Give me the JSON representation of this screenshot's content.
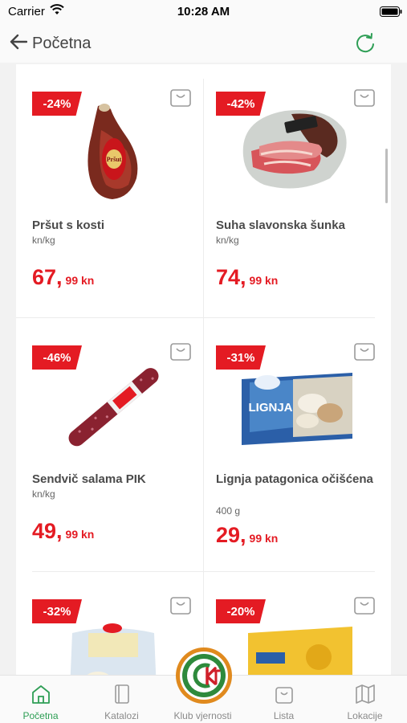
{
  "status_bar": {
    "carrier": "Carrier",
    "time": "10:28 AM"
  },
  "nav": {
    "back_label": "Početna",
    "refresh_icon": "refresh-icon"
  },
  "products": [
    {
      "name": "Pršut s kosti",
      "unit": "kn/kg",
      "price_main": "67,",
      "price_decimal": "99 kn",
      "discount": "-24%",
      "image": "prsut-ham"
    },
    {
      "name": "Suha slavonska šunka",
      "unit": "kn/kg",
      "price_main": "74,",
      "price_decimal": "99 kn",
      "discount": "-42%",
      "image": "sliced-ham"
    },
    {
      "name": "Sendvič salama PIK",
      "unit": "kn/kg",
      "price_main": "49,",
      "price_decimal": "99 kn",
      "discount": "-46%",
      "image": "salami"
    },
    {
      "name": "Lignja patagonica očišćena",
      "unit": "400 g",
      "price_main": "29,",
      "price_decimal": "99 kn",
      "discount": "-31%",
      "image": "squid-box"
    },
    {
      "name": "",
      "unit": "",
      "price_main": "",
      "price_decimal": "",
      "discount": "-32%",
      "image": "squid-rings-pack"
    },
    {
      "name": "",
      "unit": "",
      "price_main": "",
      "price_decimal": "",
      "discount": "-20%",
      "image": "gouda-cheese"
    }
  ],
  "tab_bar": {
    "tabs": [
      {
        "label": "Početna",
        "icon": "home-icon",
        "active": true
      },
      {
        "label": "Katalozi",
        "icon": "catalog-icon",
        "active": false
      },
      {
        "label": "Klub vjernosti",
        "icon": "club-logo",
        "active": false
      },
      {
        "label": "Lista",
        "icon": "shopping-bag-icon",
        "active": false
      },
      {
        "label": "Lokacije",
        "icon": "map-icon",
        "active": false
      }
    ]
  },
  "colors": {
    "accent_green": "#2e9e55",
    "discount_red": "#e41b23",
    "price_red": "#e41b23"
  }
}
